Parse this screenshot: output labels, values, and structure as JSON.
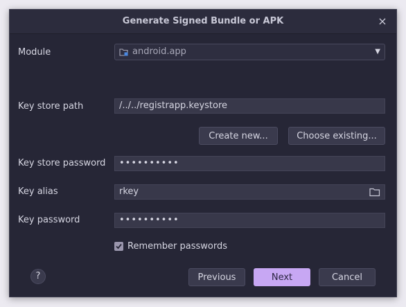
{
  "dialog": {
    "title": "Generate Signed Bundle or APK",
    "close_glyph": "×"
  },
  "module": {
    "label": "Module",
    "value": "android.app",
    "icon": "module-folder-icon",
    "dropdown_icon": "chevron-down-icon"
  },
  "keystore": {
    "path_label": "Key store path",
    "path_value": "/../../registrapp.keystore",
    "create_new_label": "Create new...",
    "choose_existing_label": "Choose existing...",
    "password_label": "Key store password",
    "password_value": "••••••••••"
  },
  "key": {
    "alias_label": "Key alias",
    "alias_value": "rkey",
    "alias_icon": "folder-icon",
    "password_label": "Key password",
    "password_value": "••••••••••"
  },
  "remember": {
    "label": "Remember passwords",
    "checked": true
  },
  "footer": {
    "help_label": "?",
    "previous_label": "Previous",
    "next_label": "Next",
    "cancel_label": "Cancel"
  },
  "colors": {
    "background": "#262636",
    "field": "#38384a",
    "accent": "#c7a7f3",
    "text": "#d6d6e2"
  }
}
